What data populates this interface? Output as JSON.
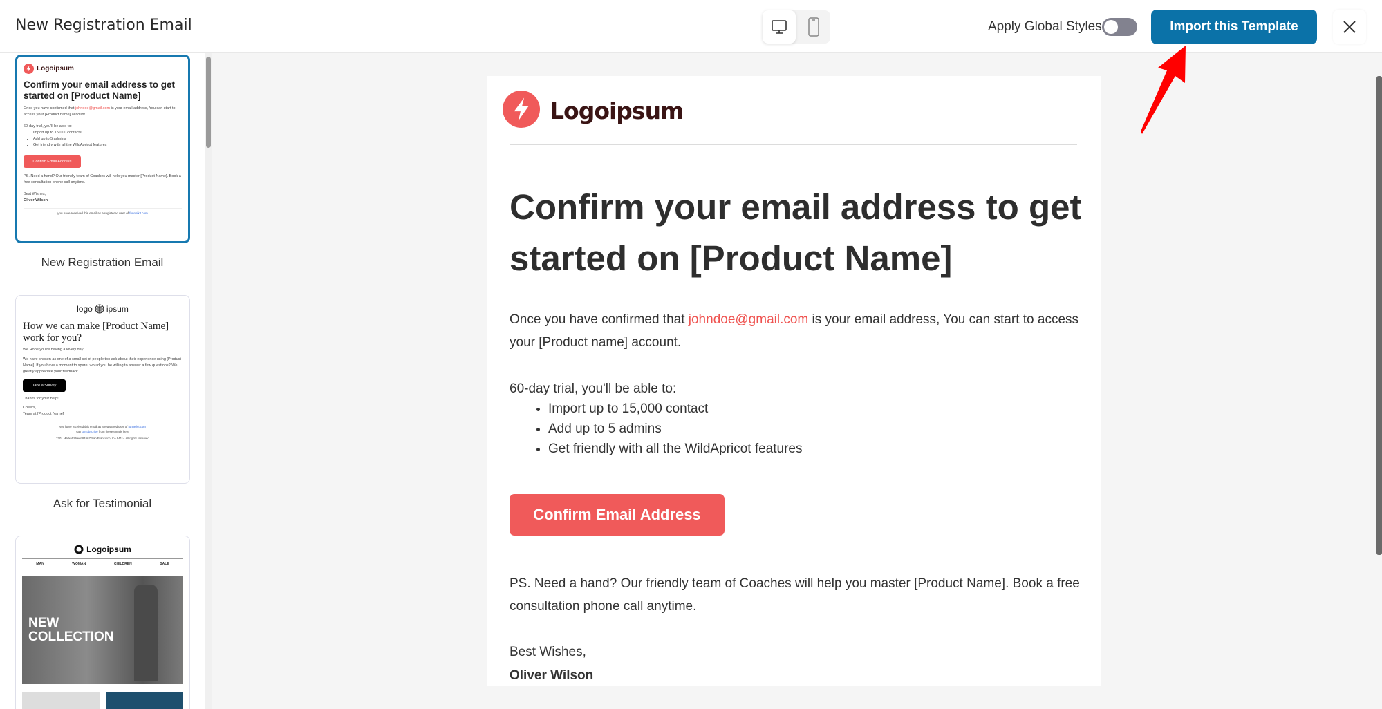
{
  "header": {
    "title": "New Registration Email",
    "apply_global_styles": "Apply Global Styles",
    "global_styles_on": false,
    "import_button": "Import this Template",
    "accent": "#0b72a8"
  },
  "sidebar": {
    "templates": [
      {
        "label": "New Registration Email",
        "selected": true,
        "logo": "Logoipsum",
        "heading": "Confirm your email address to get started on [Product Name]",
        "p1a": "Once you have confirmed that ",
        "email": "johndoe@gmail.com",
        "p1b": " is your email address, You can start to access your [Product name] account.",
        "trial": "60-day trial, you'll be able to:",
        "bullets": [
          "Import up to 15,000 contacts",
          "Add up to 5 admins",
          "Get friendly with all the WildApricot features"
        ],
        "button": "Confirm Email Address",
        "ps": "PS. Need a hand? Our friendly team of Coaches will help you master [Product Name]. Book a free consultation phone call anytime.",
        "wishes": "Best Wishes,",
        "signer": "Oliver Wilson",
        "footer_a": "you have received this email as a registered user of ",
        "footer_link": "funnelkit.com"
      },
      {
        "label": "Ask for Testimonial",
        "logo_a": "logo",
        "logo_b": "ipsum",
        "heading": "How we can make [Product Name] work for you?",
        "p1": "We Hope you're having a lovely day.",
        "p2": "We have chosen as one of a small set of people too ask about their experience using [Product Name]. If you have a moment to spare, would you be willing to answer a few questions? We greatly appreciate your feedback.",
        "button": "Take a Survey",
        "thanks": "Thanks for your help!",
        "cheers": "Cheers,",
        "team": "Team at [Product Name]",
        "footer_a": "you have received this email as a registered user of ",
        "footer_link": "funnelkit.com",
        "footer_b": "can ",
        "unsub": "unsubscribe",
        "footer_c": " from these emails here",
        "address": "2201 Market Street #4667 San Francisco, CA 94114 All rights reserved"
      },
      {
        "label": "",
        "logo": "Logoipsum",
        "nav": [
          "MAN",
          "WOMAN",
          "CHILDREN",
          "SALE"
        ],
        "hero_a": "NEW",
        "hero_b": "COLLECTION"
      }
    ]
  },
  "email": {
    "logo": "Logoipsum",
    "heading": "Confirm your email address to get started on [Product Name]",
    "p1a": "Once you have confirmed that ",
    "email": "johndoe@gmail.com",
    "p1b": " is your email address, You can start to access your [Product name] account.",
    "trial": "60-day trial, you'll be able to:",
    "bullets": [
      "Import up to 15,000 contact",
      "Add up to 5 admins",
      "Get friendly with all the WildApricot features"
    ],
    "button": "Confirm Email Address",
    "button_color": "#f05a5a",
    "ps": "PS. Need a hand? Our friendly team of Coaches will help you master [Product Name]. Book a free consultation phone call anytime.",
    "wishes": "Best Wishes,",
    "signer": "Oliver Wilson"
  }
}
